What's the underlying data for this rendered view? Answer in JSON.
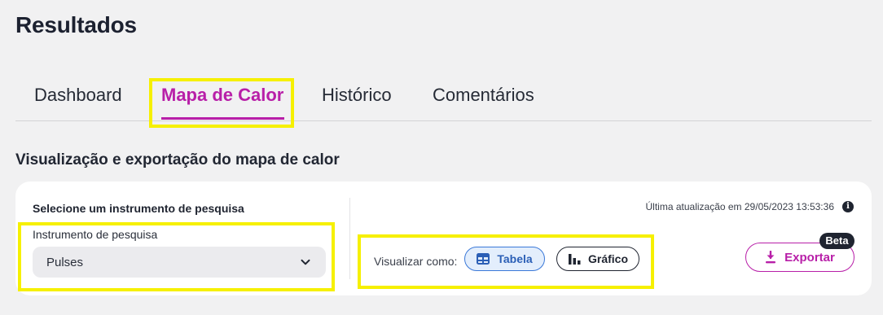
{
  "page": {
    "title": "Resultados"
  },
  "tabs": [
    {
      "label": "Dashboard",
      "active": false
    },
    {
      "label": "Mapa de Calor",
      "active": true
    },
    {
      "label": "Histórico",
      "active": false
    },
    {
      "label": "Comentários",
      "active": false
    }
  ],
  "section": {
    "title": "Visualização e exportação do mapa de calor"
  },
  "instrument": {
    "heading": "Selecione um instrumento de pesquisa",
    "field_label": "Instrumento de pesquisa",
    "selected_value": "Pulses"
  },
  "status": {
    "last_updated": "Última atualização em 29/05/2023 13:53:36"
  },
  "view": {
    "label": "Visualizar como:",
    "options": [
      {
        "label": "Tabela",
        "icon": "table-icon",
        "selected": true
      },
      {
        "label": "Gráfico",
        "icon": "bar-chart-icon",
        "selected": false
      }
    ]
  },
  "export": {
    "label": "Exportar",
    "badge": "Beta",
    "icon": "download-icon"
  },
  "colors": {
    "accent": "#b81fa8",
    "highlight": "#f6f000",
    "selected_pill_bg": "#e3eefc",
    "selected_pill_border": "#3a78d8"
  }
}
